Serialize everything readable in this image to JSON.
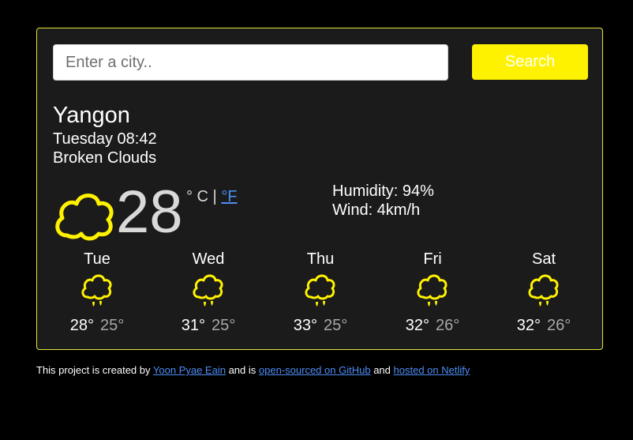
{
  "search": {
    "placeholder": "Enter a city..",
    "button_label": "Search"
  },
  "current": {
    "city": "Yangon",
    "datetime": "Tuesday 08:42",
    "description": "Broken Clouds",
    "temperature": "28",
    "unit_celsius": "° C |",
    "unit_fahrenheit": "°F",
    "humidity": "Humidity: 94%",
    "wind": "Wind: 4km/h",
    "icon": "cloud-icon"
  },
  "forecast": [
    {
      "day": "Tue",
      "max": "28°",
      "min": "25°",
      "icon": "rain-cloud-icon"
    },
    {
      "day": "Wed",
      "max": "31°",
      "min": "25°",
      "icon": "rain-cloud-icon"
    },
    {
      "day": "Thu",
      "max": "33°",
      "min": "25°",
      "icon": "rain-cloud-icon"
    },
    {
      "day": "Fri",
      "max": "32°",
      "min": "26°",
      "icon": "rain-cloud-icon"
    },
    {
      "day": "Sat",
      "max": "32°",
      "min": "26°",
      "icon": "rain-cloud-icon"
    }
  ],
  "footer": {
    "text1": "This project is created by",
    "author_link": "Yoon Pyae Eain",
    "text2": "and is",
    "github_link": "open-sourced on GitHub",
    "text3": "and",
    "netlify_link": "hosted on Netlify"
  },
  "colors": {
    "accent": "#fff200",
    "card_bg": "#1b1b1b",
    "link": "#4d8df5"
  }
}
